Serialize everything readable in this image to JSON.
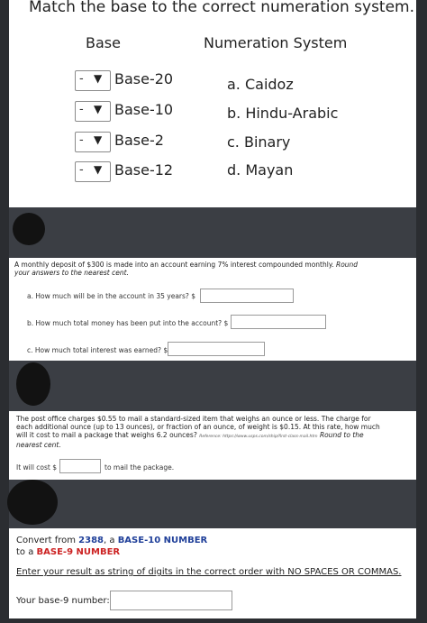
{
  "panel1": {
    "title": "Match the base to the correct numeration system.",
    "col_base": "Base",
    "col_system": "Numeration System",
    "rows": [
      {
        "select_value": "-",
        "base": "Base-20",
        "option": "a. Caidoz"
      },
      {
        "select_value": "-",
        "base": "Base-10",
        "option": "b. Hindu-Arabic"
      },
      {
        "select_value": "-",
        "base": "Base-2",
        "option": "c. Binary"
      },
      {
        "select_value": "-",
        "base": "Base-12",
        "option": "d. Mayan"
      }
    ]
  },
  "panel2": {
    "question": "A monthly deposit of $300 is made into an account earning 7% interest compounded monthly.",
    "question_emph": "Round your answers to the nearest cent.",
    "qa": "a. How much will be in the account in 35 years? $",
    "qb": "b. How much total money has been put into the account? $",
    "qc": "c. How much total interest was earned? $"
  },
  "panel3": {
    "question": "The post office charges $0.55 to mail a standard-sized item that weighs an ounce or less. The charge for each additional ounce (up to 13 ounces), or fraction of an ounce, of weight is $0.15. At this rate, how much will it cost to mail a package that weighs 6.2 ounces?",
    "reference": "Reference: https://www.usps.com/ship/first-class-mail.htm",
    "question_emph": "Round to the nearest cent.",
    "cost_prefix": "It will cost $",
    "cost_suffix": "to mail the package."
  },
  "panel4": {
    "line1_prefix": "Convert from ",
    "number": "2388",
    "line1_mid": ", a ",
    "from_base": "BASE-10 NUMBER",
    "line2_prefix": "to a ",
    "to_base": "BASE-9 NUMBER",
    "instruction": "Enter your result as string of digits in the correct order with NO SPACES OR COMMAS.",
    "answer_label": "Your base-9 number:"
  },
  "colors": {
    "background": "#2b2d31",
    "panel": "#ffffff",
    "blue": "#1f3f99",
    "red": "#cc2222"
  }
}
